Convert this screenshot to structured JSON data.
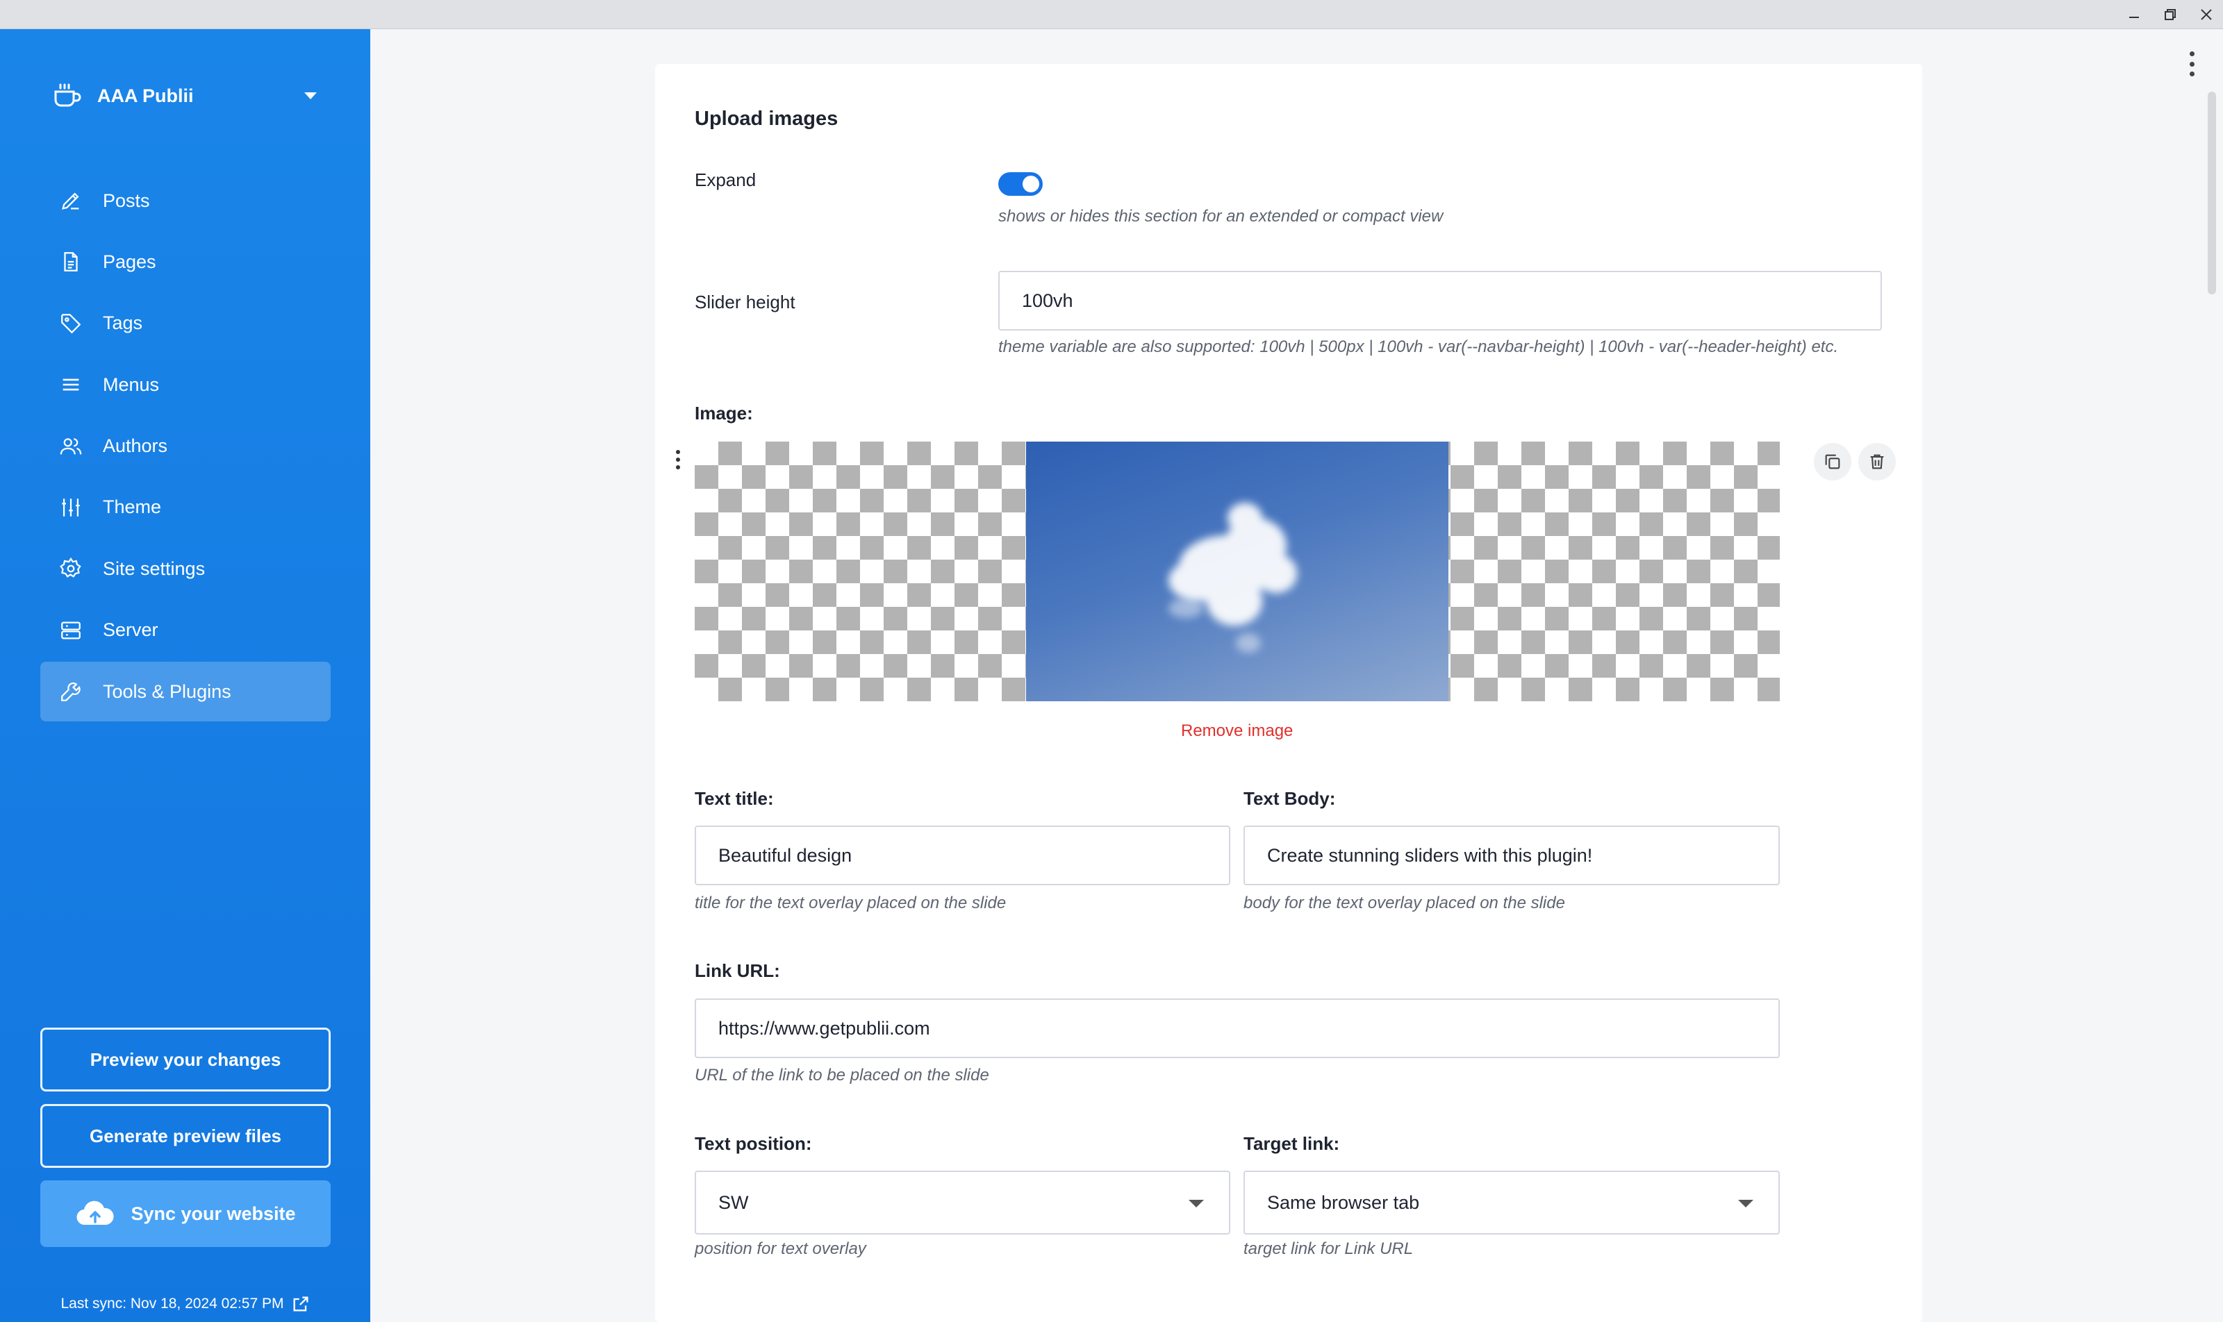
{
  "window": {
    "controls": [
      "minimize-icon",
      "restore-icon",
      "close-icon"
    ]
  },
  "sidebar": {
    "site_name": "AAA Publii",
    "nav": [
      {
        "label": "Posts",
        "icon": "pencil-icon"
      },
      {
        "label": "Pages",
        "icon": "page-icon"
      },
      {
        "label": "Tags",
        "icon": "tag-icon"
      },
      {
        "label": "Menus",
        "icon": "menu-icon"
      },
      {
        "label": "Authors",
        "icon": "users-icon"
      },
      {
        "label": "Theme",
        "icon": "sliders-icon"
      },
      {
        "label": "Site settings",
        "icon": "gear-icon"
      },
      {
        "label": "Server",
        "icon": "server-icon"
      },
      {
        "label": "Tools & Plugins",
        "icon": "wrench-icon",
        "active": true
      }
    ],
    "preview_label": "Preview your changes",
    "generate_label": "Generate preview files",
    "sync_label": "Sync your website",
    "last_sync": "Last sync: Nov 18, 2024 02:57 PM"
  },
  "panel": {
    "title": "Upload images",
    "expand": {
      "label": "Expand",
      "enabled": true,
      "hint": "shows or hides this section for an extended or compact view"
    },
    "slider_height": {
      "label": "Slider height",
      "value": "100vh",
      "hint": "theme variable are also supported: 100vh | 500px | 100vh - var(--navbar-height) | 100vh - var(--header-height) etc."
    },
    "image": {
      "label": "Image:",
      "remove_label": "Remove image"
    },
    "text_title": {
      "label": "Text title:",
      "value": "Beautiful design",
      "hint": "title for the text overlay placed on the slide"
    },
    "text_body": {
      "label": "Text Body:",
      "value": "Create stunning sliders with this plugin!",
      "hint": "body for the text overlay placed on the slide"
    },
    "link_url": {
      "label": "Link URL:",
      "value": "https://www.getpublii.com",
      "hint": "URL of the link to be placed on the slide"
    },
    "text_position": {
      "label": "Text position:",
      "value": "SW",
      "hint": "position for text overlay"
    },
    "target_link": {
      "label": "Target link:",
      "value": "Same browser tab",
      "hint": "target link for Link URL"
    }
  },
  "colors": {
    "sidebar": "#1a85e8",
    "accent": "#1774e6",
    "danger": "#e0302b"
  }
}
